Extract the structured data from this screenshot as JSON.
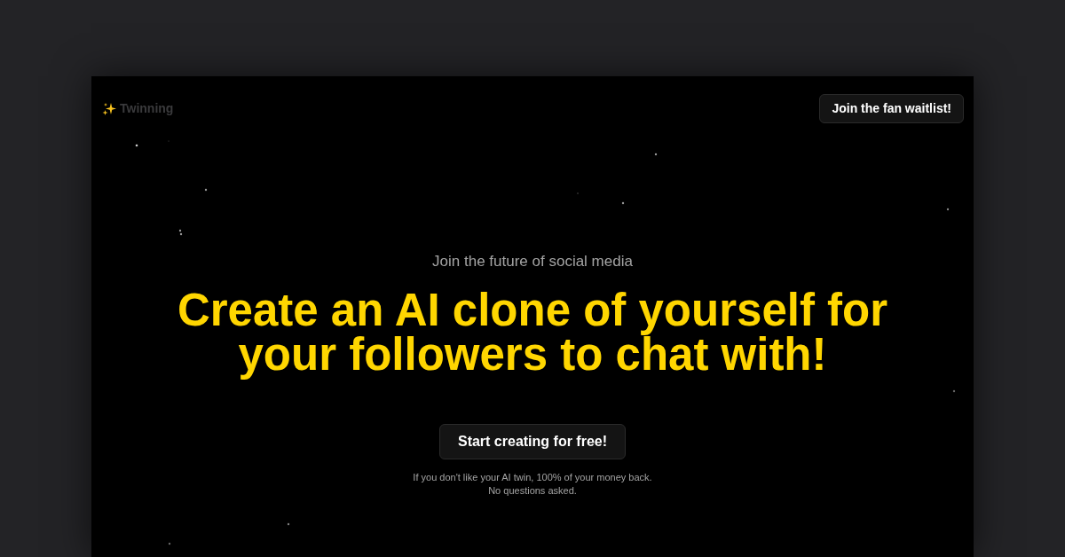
{
  "header": {
    "logo": "Twinning",
    "button": "Join the fan waitlist!"
  },
  "hero": {
    "eyebrow": "Join the future of social media",
    "headline": "Create an AI clone of yourself for your followers to chat with!",
    "cta": "Start creating for free!",
    "note": [
      "If you don't like your AI twin, 100% of your money back.",
      "No questions asked."
    ]
  }
}
